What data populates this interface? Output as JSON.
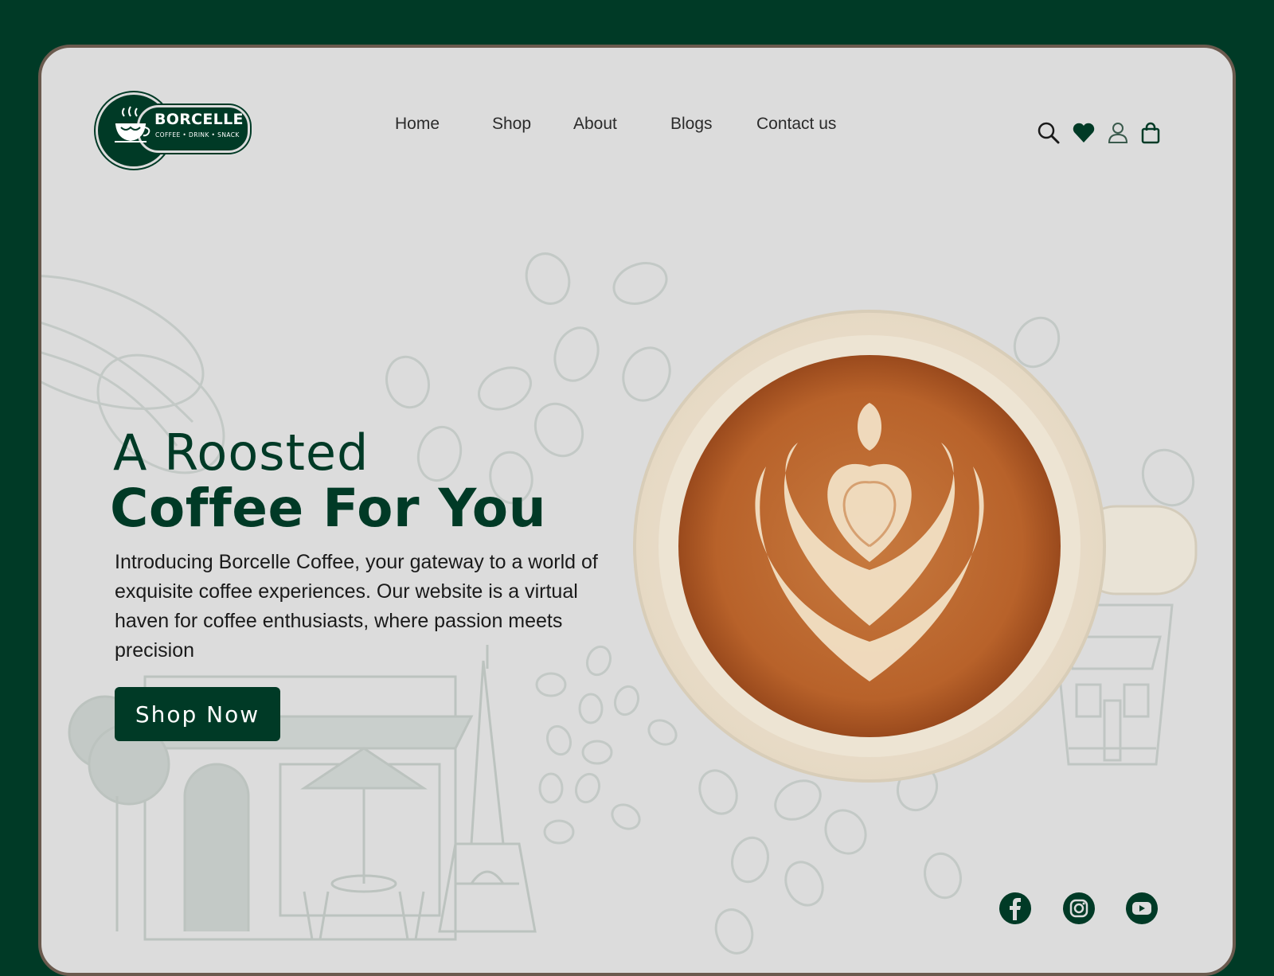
{
  "brand": {
    "name": "BORCELLE",
    "tagline": "COFFEE • DRINK • SNACK"
  },
  "nav": {
    "items": [
      {
        "label": "Home"
      },
      {
        "label": "Shop"
      },
      {
        "label": "About"
      },
      {
        "label": "Blogs"
      },
      {
        "label": "Contact us"
      }
    ]
  },
  "header_icons": [
    "search-icon",
    "heart-icon",
    "user-icon",
    "shopping-bag-icon"
  ],
  "hero": {
    "title_line1": "A Roosted",
    "title_line2": "Coffee For You",
    "description": "Introducing Borcelle Coffee, your gateway to a world of exquisite coffee experiences. Our website is a virtual haven for coffee enthusiasts, where passion meets precision",
    "cta_label": "Shop Now"
  },
  "social": [
    "facebook-icon",
    "instagram-icon",
    "youtube-icon"
  ],
  "colors": {
    "brand_green": "#003a26",
    "panel_bg": "#dcdcdc",
    "frame_border": "#6b5a4e",
    "coffee": "#b8622a"
  }
}
